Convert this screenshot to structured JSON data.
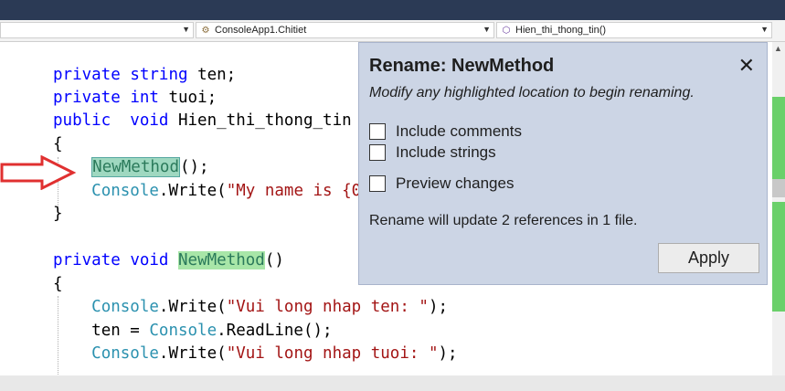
{
  "navbar": {
    "project_label": "",
    "class_label": "ConsoleApp1.Chitiet",
    "member_label": "Hien_thi_thong_tin()"
  },
  "code": {
    "line1": {
      "kw": "private",
      "type": "string",
      "rest": " ten;"
    },
    "line2": {
      "kw": "private",
      "type": "int",
      "rest": " tuoi;"
    },
    "line3": {
      "kw1": "public",
      "kw2": "void",
      "rest": " Hien_thi_thong_tin"
    },
    "line4": "{",
    "line5": {
      "method": "NewMethod",
      "rest": "();"
    },
    "line6": {
      "type": "Console",
      "mid": ".Write(",
      "str": "\"My name is {0"
    },
    "line7": "}",
    "line8": {
      "kw1": "private",
      "kw2": "void",
      "method": "NewMethod",
      "rest": "()"
    },
    "line9": "{",
    "line10": {
      "type": "Console",
      "mid": ".Write(",
      "str": "\"Vui long nhap ten: \"",
      "end": ");"
    },
    "line11": {
      "pre": "ten = ",
      "type": "Console",
      "mid": ".ReadLine();"
    },
    "line12": {
      "type": "Console",
      "mid": ".Write(",
      "str": "\"Vui long nhap tuoi: \"",
      "end": ");"
    }
  },
  "rename_panel": {
    "title": "Rename: NewMethod",
    "subtitle": "Modify any highlighted location to begin renaming.",
    "options": [
      {
        "label": "Include comments",
        "checked": false
      },
      {
        "label": "Include strings",
        "checked": false
      },
      {
        "label": "Preview changes",
        "checked": false
      }
    ],
    "info": "Rename will update 2 references in 1 file.",
    "apply_label": "Apply",
    "close_symbol": "✕"
  },
  "colors": {
    "keyword": "#0000ff",
    "type": "#2b91af",
    "string": "#a31515",
    "rename_bg": "#ccd5e5",
    "arrow": "#e03030"
  }
}
